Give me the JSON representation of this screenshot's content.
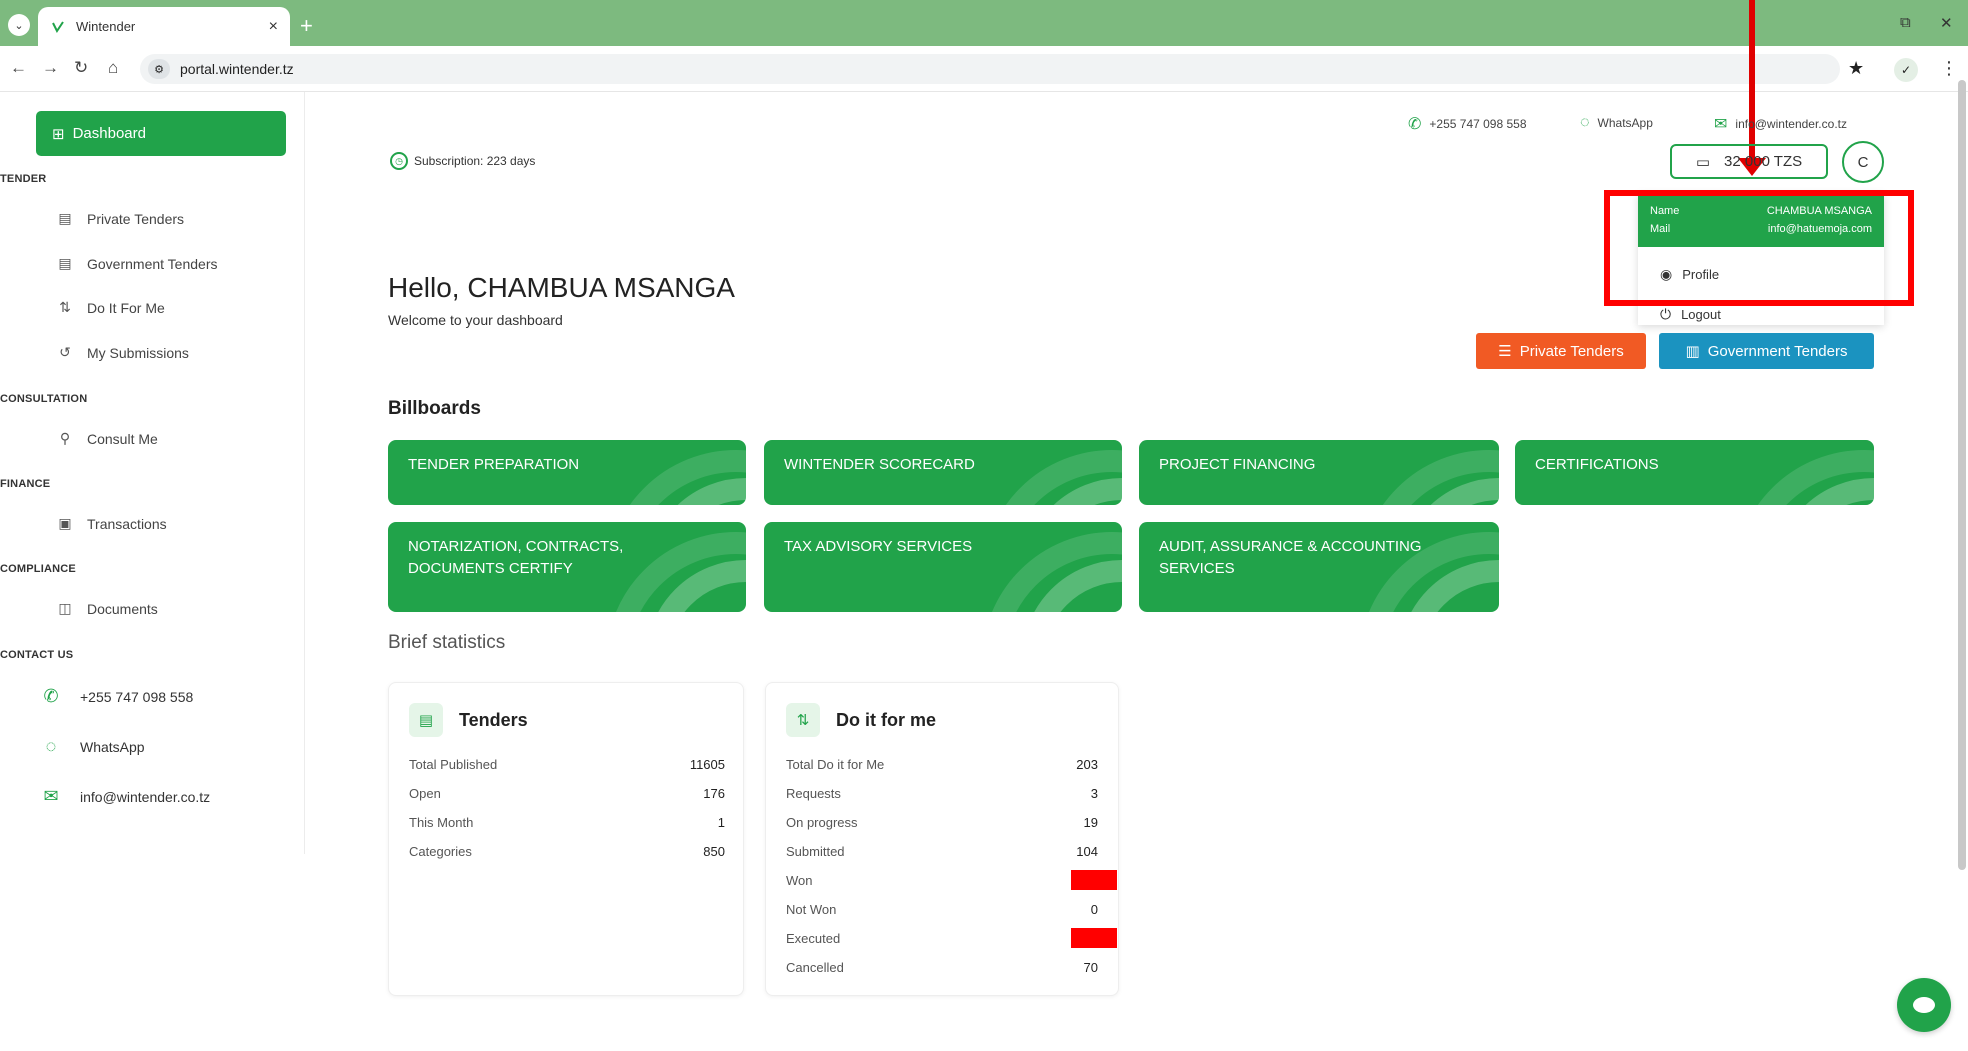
{
  "browser": {
    "tab_title": "Wintender",
    "url": "portal.wintender.tz",
    "new_tab": "+",
    "close": "×",
    "restore": "⧉",
    "win_close": "✕"
  },
  "sidebar": {
    "dashboard": "Dashboard",
    "sections": {
      "tender": "TENDER",
      "consultation": "CONSULTATION",
      "finance": "FINANCE",
      "compliance": "COMPLIANCE",
      "contact": "CONTACT US"
    },
    "tender_items": [
      "Private Tenders",
      "Government Tenders",
      "Do It For Me",
      "My Submissions"
    ],
    "consult_items": [
      "Consult Me"
    ],
    "finance_items": [
      "Transactions"
    ],
    "compliance_items": [
      "Documents"
    ],
    "contact_items": [
      "+255 747 098 558",
      "WhatsApp",
      "info@wintender.co.tz"
    ]
  },
  "header": {
    "subscription": "Subscription: 223 days",
    "phone": "+255 747 098 558",
    "whatsapp": "WhatsApp",
    "email": "info@wintender.co.tz",
    "balance": "32 000 TZS",
    "avatar_letter": "C"
  },
  "dropdown": {
    "name_label": "Name",
    "name_value": "CHAMBUA MSANGA",
    "mail_label": "Mail",
    "mail_value": "info@hatuemoja.com",
    "profile": "Profile",
    "logout": "Logout"
  },
  "main": {
    "hello": "Hello, CHAMBUA MSANGA",
    "welcome": "Welcome to your dashboard",
    "private_btn": "Private Tenders",
    "gov_btn": "Government Tenders",
    "billboards_title": "Billboards",
    "billboards": [
      "TENDER PREPARATION",
      "WINTENDER SCORECARD",
      "PROJECT FINANCING",
      "CERTIFICATIONS",
      "NOTARIZATION, CONTRACTS, DOCUMENTS CERTIFY",
      "TAX ADVISORY SERVICES",
      "AUDIT, ASSURANCE & ACCOUNTING SERVICES"
    ],
    "brief": "Brief statistics"
  },
  "stats": {
    "tenders": {
      "title": "Tenders",
      "rows": [
        {
          "label": "Total Published",
          "value": "11605"
        },
        {
          "label": "Open",
          "value": "176"
        },
        {
          "label": "This Month",
          "value": "1"
        },
        {
          "label": "Categories",
          "value": "850"
        }
      ]
    },
    "difm": {
      "title": "Do it for me",
      "rows": [
        {
          "label": "Total Do it for Me",
          "value": "203"
        },
        {
          "label": "Requests",
          "value": "3"
        },
        {
          "label": "On progress",
          "value": "19"
        },
        {
          "label": "Submitted",
          "value": "104"
        },
        {
          "label": "Won",
          "value": ""
        },
        {
          "label": "Not Won",
          "value": "0"
        },
        {
          "label": "Executed",
          "value": ""
        },
        {
          "label": "Cancelled",
          "value": "70"
        }
      ]
    }
  },
  "colors": {
    "brand_green": "#21a34a",
    "orange": "#f15a24",
    "blue": "#1b93c0",
    "redaction": "#ff0000"
  }
}
